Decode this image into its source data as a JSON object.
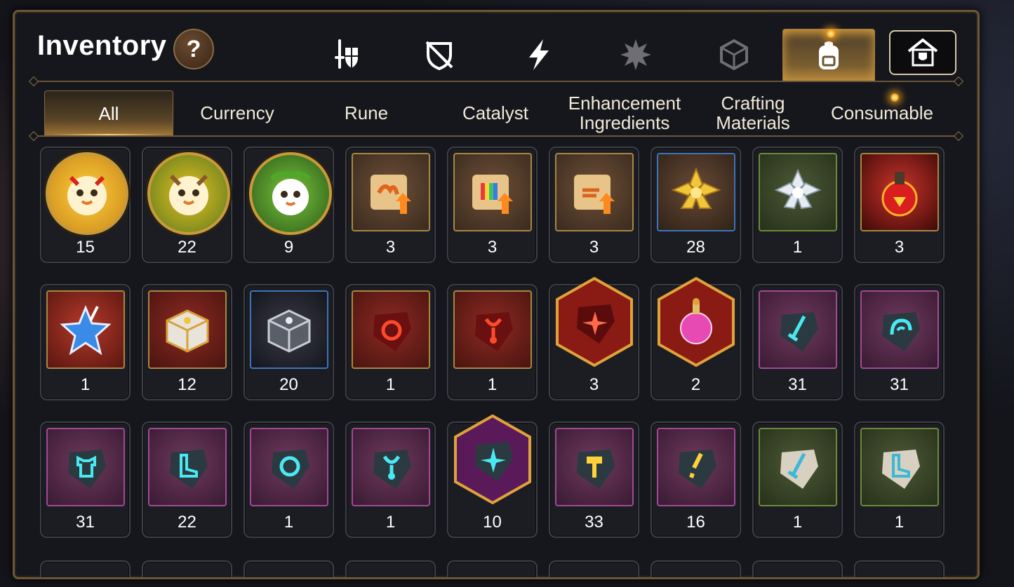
{
  "window": {
    "title": "Inventory",
    "help_label": "?"
  },
  "category_tabs": [
    {
      "icon": "sword-shield-icon",
      "active": false
    },
    {
      "icon": "broken-shield-icon",
      "active": false
    },
    {
      "icon": "lightning-icon",
      "active": false
    },
    {
      "icon": "spiked-burst-icon",
      "active": false
    },
    {
      "icon": "cube-icon",
      "active": false
    },
    {
      "icon": "backpack-icon",
      "active": true
    },
    {
      "icon": "storage-house-icon",
      "active": false
    }
  ],
  "sub_tabs": [
    {
      "label": "All",
      "active": true
    },
    {
      "label": "Currency",
      "active": false
    },
    {
      "label": "Rune",
      "active": false
    },
    {
      "label": "Catalyst",
      "active": false
    },
    {
      "label": "Enhancement Ingredients",
      "active": false
    },
    {
      "label": "Crafting Materials",
      "active": false
    },
    {
      "label": "Consumable",
      "active": false
    }
  ],
  "items": [
    [
      {
        "icon": "yellow-mascot-icon",
        "frame": "round",
        "qty": "15"
      },
      {
        "icon": "green-mascot-icon",
        "frame": "round",
        "qty": "22"
      },
      {
        "icon": "leaf-mascot-icon",
        "frame": "round",
        "qty": "9"
      },
      {
        "icon": "fire-scroll-icon",
        "frame": "square",
        "qty": "3"
      },
      {
        "icon": "rainbow-scroll-icon",
        "frame": "square",
        "qty": "3"
      },
      {
        "icon": "gold-scroll-icon",
        "frame": "square",
        "qty": "3"
      },
      {
        "icon": "gold-flower-icon",
        "frame": "square",
        "qty": "28"
      },
      {
        "icon": "silver-flower-icon",
        "frame": "square",
        "qty": "1"
      },
      {
        "icon": "red-potion-icon",
        "frame": "square",
        "qty": "3"
      }
    ],
    [
      {
        "icon": "blue-star-icon",
        "frame": "square",
        "qty": "1"
      },
      {
        "icon": "gold-chest-icon",
        "frame": "square",
        "qty": "12"
      },
      {
        "icon": "silver-chest-icon",
        "frame": "square",
        "qty": "20"
      },
      {
        "icon": "red-ring-rune-icon",
        "frame": "square",
        "qty": "1"
      },
      {
        "icon": "red-necklace-rune-icon",
        "frame": "square",
        "qty": "1"
      },
      {
        "icon": "red-star-rune-icon",
        "frame": "hex",
        "qty": "3"
      },
      {
        "icon": "pink-potion-icon",
        "frame": "hex",
        "qty": "2"
      },
      {
        "icon": "cyan-sword-rune-icon",
        "frame": "square",
        "qty": "31"
      },
      {
        "icon": "cyan-helm-rune-icon",
        "frame": "square",
        "qty": "31"
      }
    ],
    [
      {
        "icon": "cyan-armor-rune-icon",
        "frame": "square",
        "qty": "31"
      },
      {
        "icon": "cyan-boots-rune-icon",
        "frame": "square",
        "qty": "22"
      },
      {
        "icon": "cyan-ring-rune-icon",
        "frame": "square",
        "qty": "1"
      },
      {
        "icon": "cyan-necklace-rune-icon",
        "frame": "square",
        "qty": "1"
      },
      {
        "icon": "cyan-star-rune-icon",
        "frame": "hex",
        "qty": "10"
      },
      {
        "icon": "gold-hammer-rune-icon",
        "frame": "square",
        "qty": "33"
      },
      {
        "icon": "gold-bolt-rune-icon",
        "frame": "square",
        "qty": "16"
      },
      {
        "icon": "stone-sword-rune-icon",
        "frame": "square",
        "qty": "1"
      },
      {
        "icon": "stone-boots-rune-icon",
        "frame": "square",
        "qty": "1"
      }
    ]
  ]
}
